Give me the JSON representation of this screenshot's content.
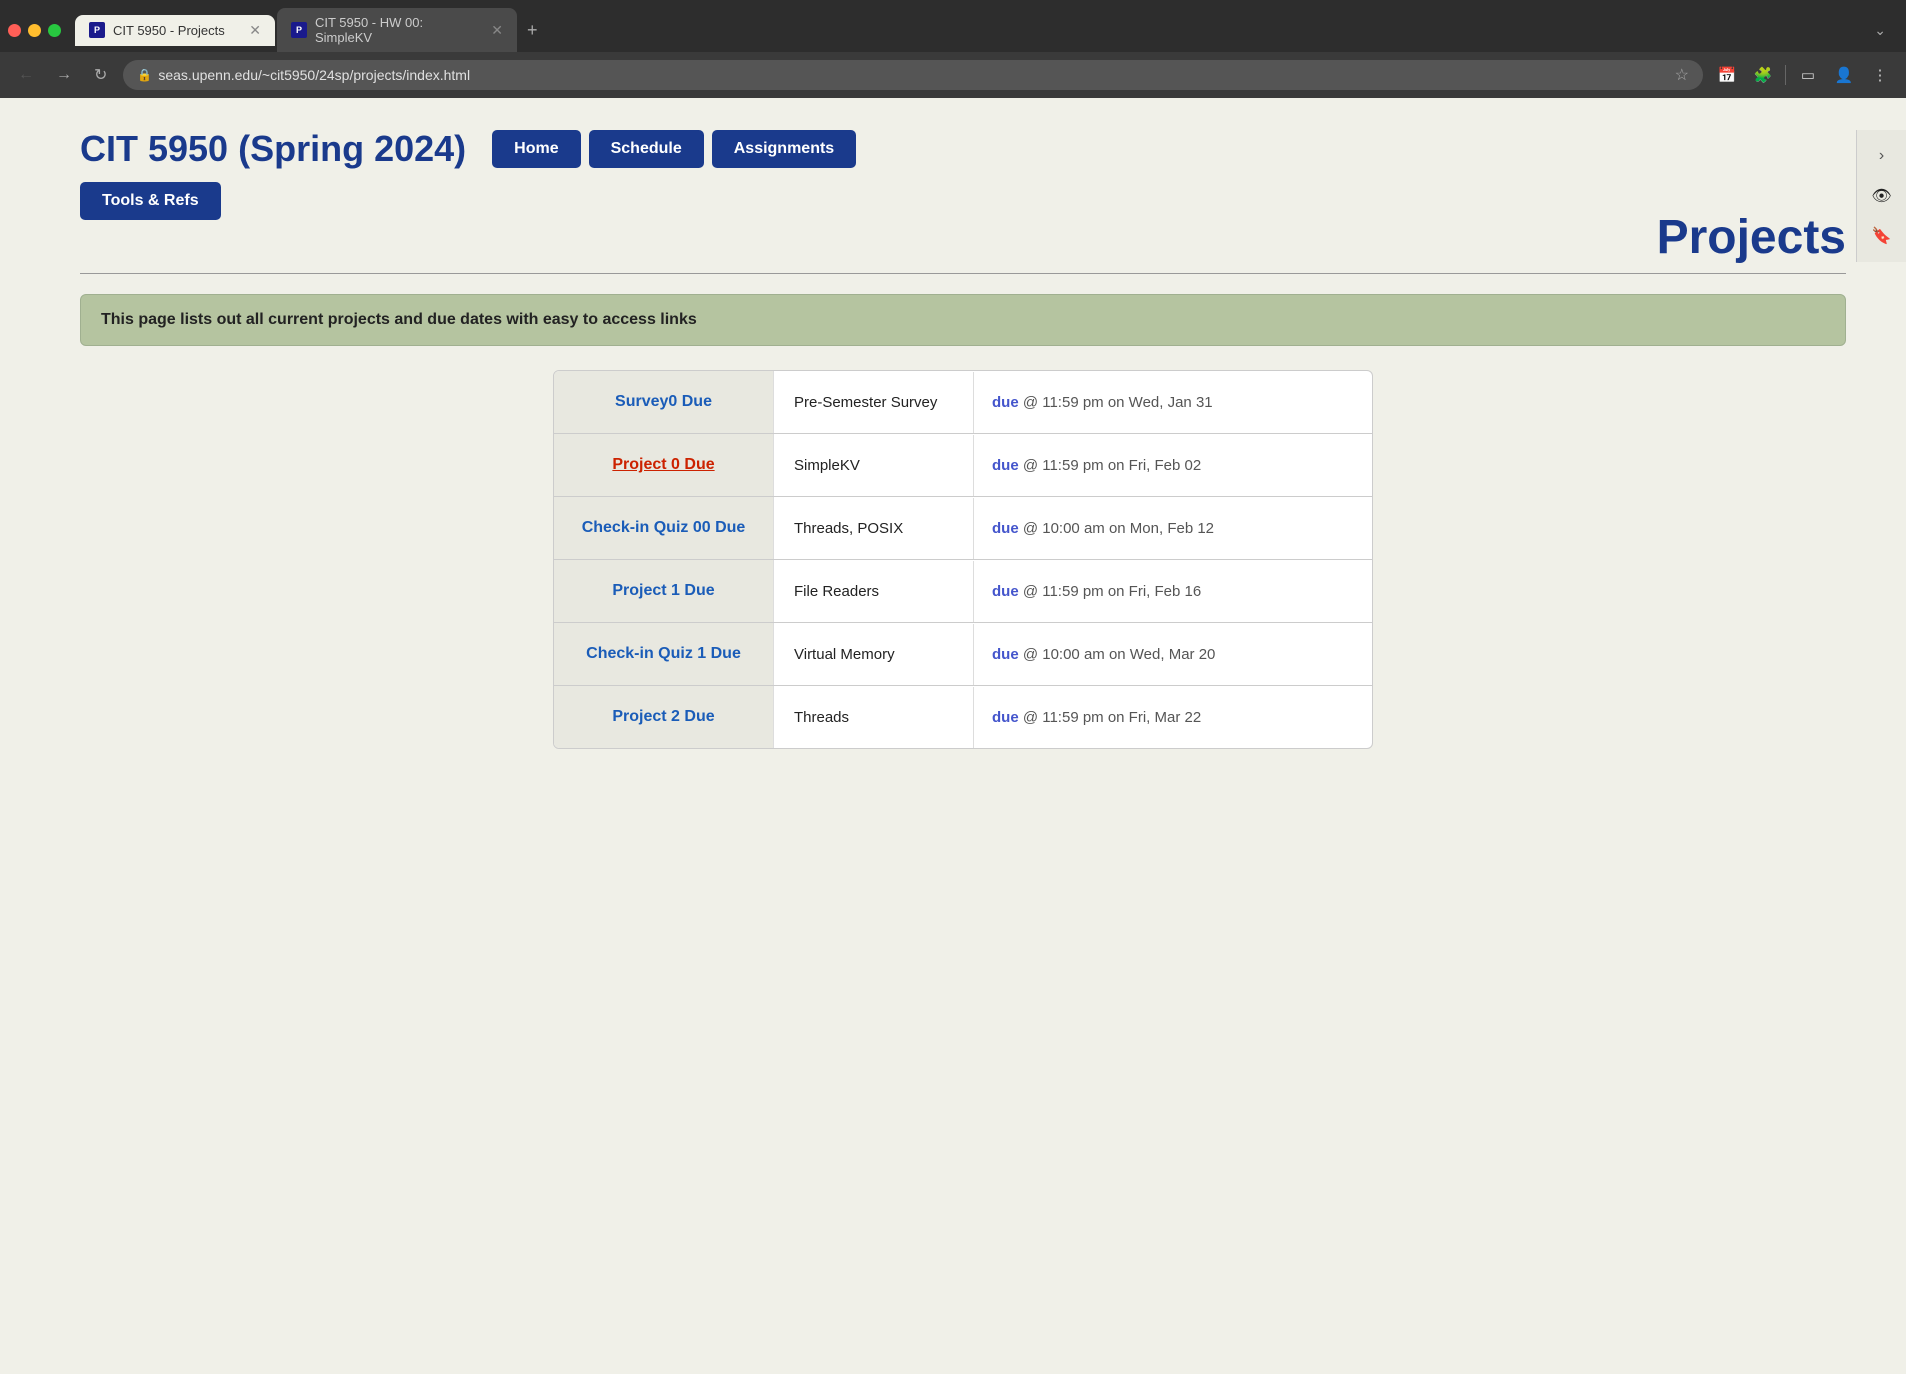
{
  "browser": {
    "tabs": [
      {
        "id": "tab1",
        "title": "CIT 5950 - Projects",
        "url": "seas.upenn.edu/~cit5950/24sp/projects/index.html",
        "active": true
      },
      {
        "id": "tab2",
        "title": "CIT 5950 - HW 00: SimpleKV",
        "url": "",
        "active": false
      }
    ],
    "active_url": "seas.upenn.edu/~cit5950/24sp/projects/index.html"
  },
  "page": {
    "site_title": "CIT 5950 (Spring 2024)",
    "page_heading": "Projects",
    "info_text": "This page lists out all current projects and due dates with easy to access links",
    "nav": {
      "home_label": "Home",
      "schedule_label": "Schedule",
      "assignments_label": "Assignments",
      "tools_label": "Tools & Refs"
    },
    "table_rows": [
      {
        "label": "Survey0 Due",
        "label_color": "blue",
        "description": "Pre-Semester Survey",
        "due_word": "due",
        "due_rest": " @ 11:59 pm on Wed, Jan 31"
      },
      {
        "label": "Project 0 Due",
        "label_color": "red",
        "description": "SimpleKV",
        "due_word": "due",
        "due_rest": " @ 11:59 pm on Fri, Feb 02"
      },
      {
        "label": "Check-in Quiz 00 Due",
        "label_color": "blue",
        "description": "Threads, POSIX",
        "due_word": "due",
        "due_rest": " @ 10:00 am on Mon, Feb 12"
      },
      {
        "label": "Project 1 Due",
        "label_color": "blue",
        "description": "File Readers",
        "due_word": "due",
        "due_rest": " @ 11:59 pm on Fri, Feb 16"
      },
      {
        "label": "Check-in Quiz 1 Due",
        "label_color": "blue",
        "description": "Virtual Memory",
        "due_word": "due",
        "due_rest": " @ 10:00 am on Wed, Mar 20"
      },
      {
        "label": "Project 2 Due",
        "label_color": "blue",
        "description": "Threads",
        "due_word": "due",
        "due_rest": " @ 11:59 pm on Fri, Mar 22"
      }
    ]
  }
}
